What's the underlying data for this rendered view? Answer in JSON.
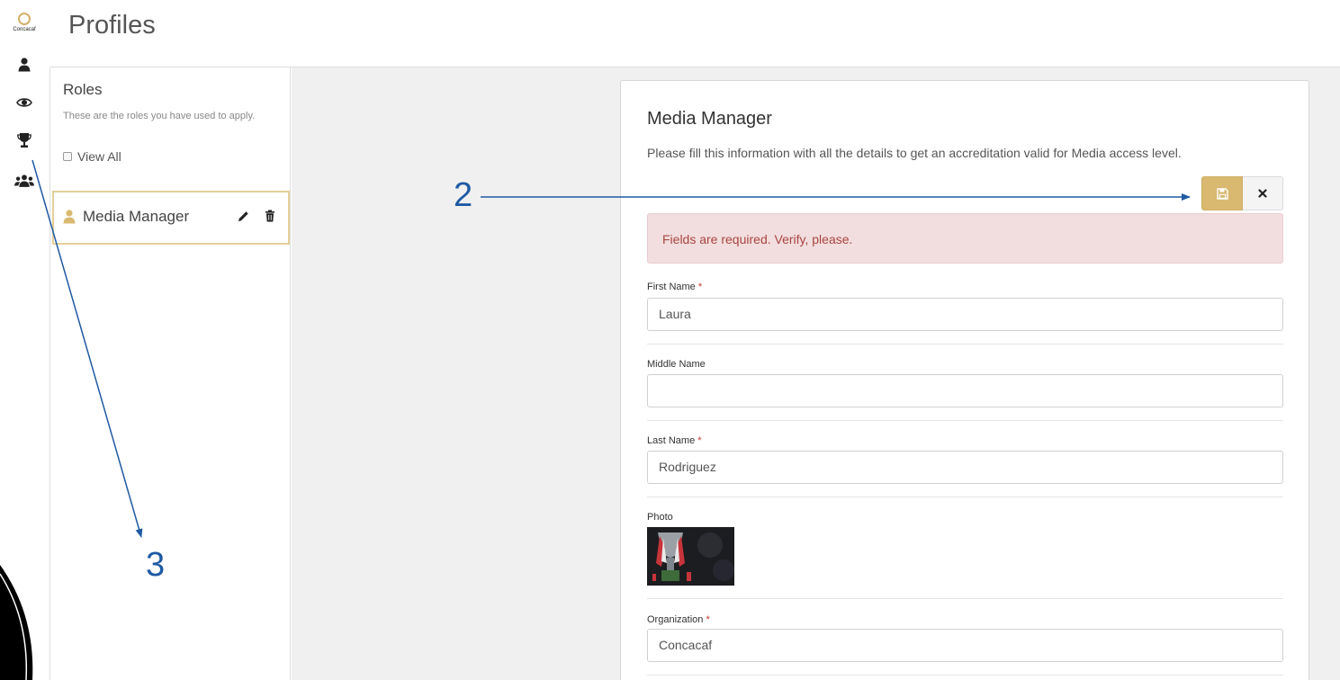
{
  "rail": {
    "logo_text": "Concacaf",
    "icons": [
      "user-icon",
      "eye-icon",
      "trophy-icon",
      "users-icon"
    ]
  },
  "header": {
    "title": "Profiles"
  },
  "roles": {
    "title": "Roles",
    "description": "These are the roles you have used to apply.",
    "view_all_label": "View All",
    "items": [
      {
        "label": "Media Manager",
        "icon": "user-icon"
      }
    ]
  },
  "form": {
    "title": "Media Manager",
    "description": "Please fill this information with all the details to get an accreditation valid for Media access level.",
    "alert": "Fields are required. Verify, please.",
    "required_mark": "*",
    "fields": {
      "first_name": {
        "label": "First Name",
        "value": "Laura",
        "required": true
      },
      "middle_name": {
        "label": "Middle Name",
        "value": "",
        "required": false
      },
      "last_name": {
        "label": "Last Name",
        "value": "Rodriguez",
        "required": true
      },
      "photo": {
        "label": "Photo"
      },
      "organization": {
        "label": "Organization",
        "value": "Concacaf",
        "required": true
      }
    }
  },
  "annotations": {
    "callout_2": "2",
    "callout_3": "3"
  },
  "colors": {
    "accent": "#d9b870",
    "alert_bg": "#f2dede",
    "alert_text": "#a94442",
    "annotation": "#1f5aa3"
  }
}
